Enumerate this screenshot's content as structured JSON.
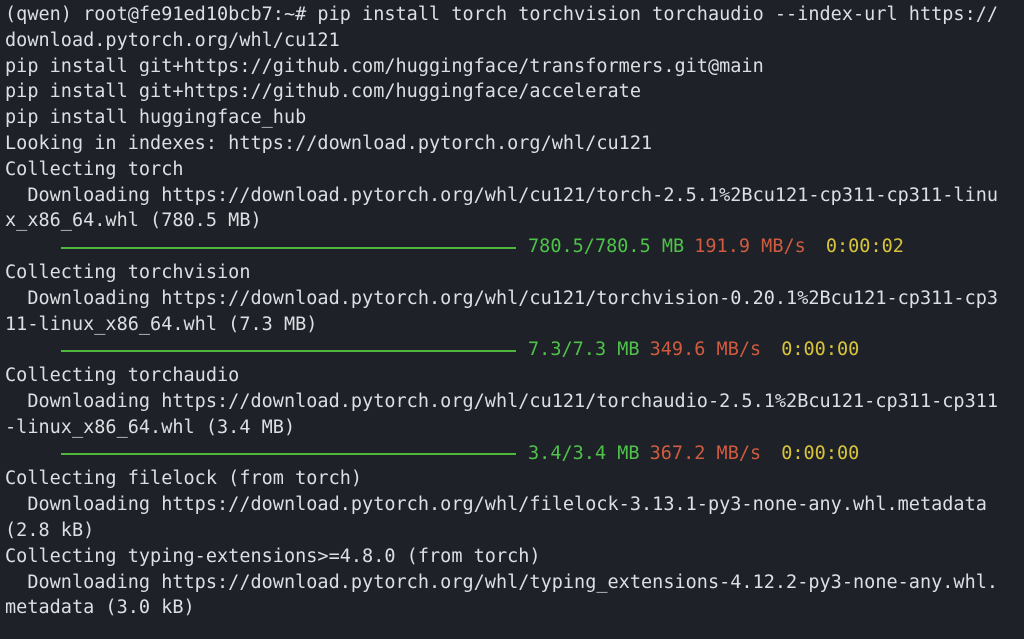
{
  "terminal": {
    "lines": [
      {
        "kind": "text",
        "text": "(qwen) root@fe91ed10bcb7:~# pip install torch torchvision torchaudio --index-url https://"
      },
      {
        "kind": "text",
        "text": "download.pytorch.org/whl/cu121"
      },
      {
        "kind": "text",
        "text": "pip install git+https://github.com/huggingface/transformers.git@main"
      },
      {
        "kind": "text",
        "text": "pip install git+https://github.com/huggingface/accelerate"
      },
      {
        "kind": "text",
        "text": "pip install huggingface_hub"
      },
      {
        "kind": "text",
        "text": "Looking in indexes: https://download.pytorch.org/whl/cu121"
      },
      {
        "kind": "text",
        "text": "Collecting torch"
      },
      {
        "kind": "text",
        "text": "  Downloading https://download.pytorch.org/whl/cu121/torch-2.5.1%2Bcu121-cp311-cp311-linu"
      },
      {
        "kind": "text",
        "text": "x_x86_64.whl (780.5 MB)"
      },
      {
        "kind": "bar",
        "size": "780.5/780.5 MB",
        "speed": "191.9 MB/s",
        "eta": "0:00:02",
        "progress": 1.0
      },
      {
        "kind": "text",
        "text": "Collecting torchvision"
      },
      {
        "kind": "text",
        "text": "  Downloading https://download.pytorch.org/whl/cu121/torchvision-0.20.1%2Bcu121-cp311-cp3"
      },
      {
        "kind": "text",
        "text": "11-linux_x86_64.whl (7.3 MB)"
      },
      {
        "kind": "bar",
        "size": "7.3/7.3 MB",
        "speed": "349.6 MB/s",
        "eta": "0:00:00",
        "progress": 1.0
      },
      {
        "kind": "text",
        "text": "Collecting torchaudio"
      },
      {
        "kind": "text",
        "text": "  Downloading https://download.pytorch.org/whl/cu121/torchaudio-2.5.1%2Bcu121-cp311-cp311"
      },
      {
        "kind": "text",
        "text": "-linux_x86_64.whl (3.4 MB)"
      },
      {
        "kind": "bar",
        "size": "3.4/3.4 MB",
        "speed": "367.2 MB/s",
        "eta": "0:00:00",
        "progress": 1.0
      },
      {
        "kind": "text",
        "text": "Collecting filelock (from torch)"
      },
      {
        "kind": "text",
        "text": "  Downloading https://download.pytorch.org/whl/filelock-3.13.1-py3-none-any.whl.metadata"
      },
      {
        "kind": "text",
        "text": "(2.8 kB)"
      },
      {
        "kind": "text",
        "text": "Collecting typing-extensions>=4.8.0 (from torch)"
      },
      {
        "kind": "text",
        "text": "  Downloading https://download.pytorch.org/whl/typing_extensions-4.12.2-py3-none-any.whl."
      },
      {
        "kind": "text",
        "text": "metadata (3.0 kB)"
      }
    ]
  },
  "colors": {
    "background": "#1e2127",
    "foreground": "#dcdfe4",
    "progress_bar": "#4db83b",
    "size_text": "#4ec24a",
    "speed_text": "#d05b3f",
    "eta_text": "#d7c43c"
  }
}
